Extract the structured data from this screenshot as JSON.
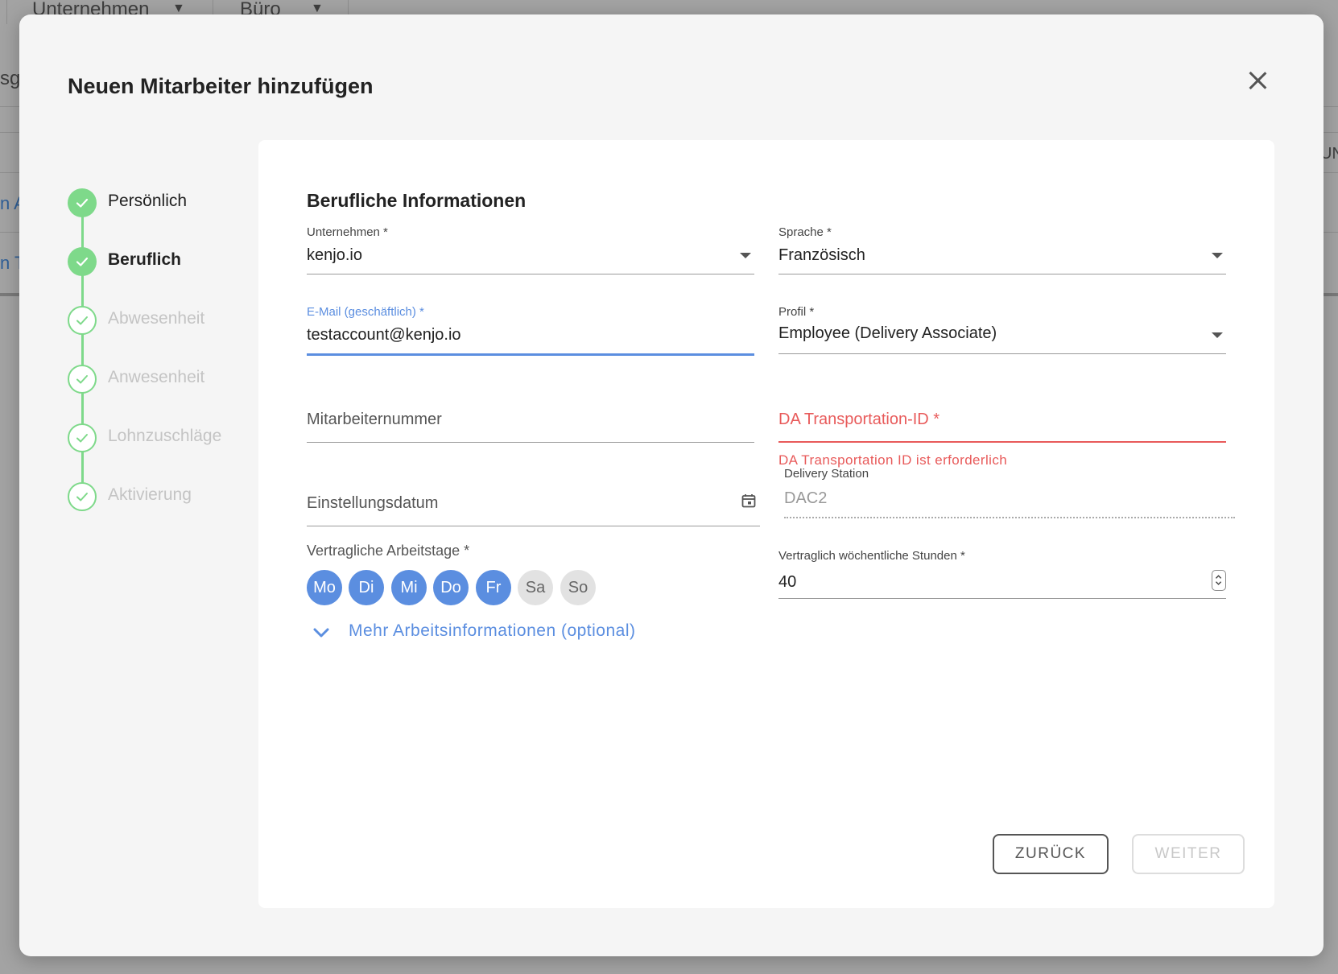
{
  "background": {
    "col1_header": "Unternehmen",
    "col2_header": "Büro",
    "left_fragment_1": "sg",
    "left_fragment_2": "n A",
    "left_fragment_3": "n T",
    "right_fragment": "UN"
  },
  "modal": {
    "title": "Neuen Mitarbeiter hinzufügen",
    "close_icon": "close-icon"
  },
  "stepper": {
    "steps": [
      {
        "label": "Persönlich",
        "state": "done"
      },
      {
        "label": "Beruflich",
        "state": "current"
      },
      {
        "label": "Abwesenheit",
        "state": "pending"
      },
      {
        "label": "Anwesenheit",
        "state": "pending"
      },
      {
        "label": "Lohnzuschläge",
        "state": "pending"
      },
      {
        "label": "Aktivierung",
        "state": "pending"
      }
    ]
  },
  "form": {
    "section_title": "Berufliche Informationen",
    "company": {
      "label": "Unternehmen *",
      "value": "kenjo.io"
    },
    "language": {
      "label": "Sprache *",
      "value": "Französisch"
    },
    "email": {
      "label": "E-Mail (geschäftlich) *",
      "value": "testaccount@kenjo.io"
    },
    "profile": {
      "label": "Profil *",
      "value": "Employee (Delivery Associate)"
    },
    "employee_number": {
      "placeholder": "Mitarbeiternummer"
    },
    "da_transportation": {
      "placeholder": "DA Transportation-ID *",
      "error": "DA Transportation ID ist erforderlich"
    },
    "hire_date": {
      "placeholder": "Einstellungsdatum"
    },
    "delivery_station": {
      "label": "Delivery Station",
      "value": "DAC2"
    },
    "workdays": {
      "label": "Vertragliche Arbeitstage *",
      "days": [
        {
          "label": "Mo",
          "selected": true
        },
        {
          "label": "Di",
          "selected": true
        },
        {
          "label": "Mi",
          "selected": true
        },
        {
          "label": "Do",
          "selected": true
        },
        {
          "label": "Fr",
          "selected": true
        },
        {
          "label": "Sa",
          "selected": false
        },
        {
          "label": "So",
          "selected": false
        }
      ]
    },
    "weekly_hours": {
      "label": "Vertraglich wöchentliche Stunden *",
      "value": "40"
    },
    "more_info": "Mehr Arbeitsinformationen (optional)"
  },
  "actions": {
    "back": "ZURÜCK",
    "next": "WEITER"
  },
  "colors": {
    "accent": "#5b8ee0",
    "success": "#7ed98a",
    "error": "#e85a5a"
  }
}
